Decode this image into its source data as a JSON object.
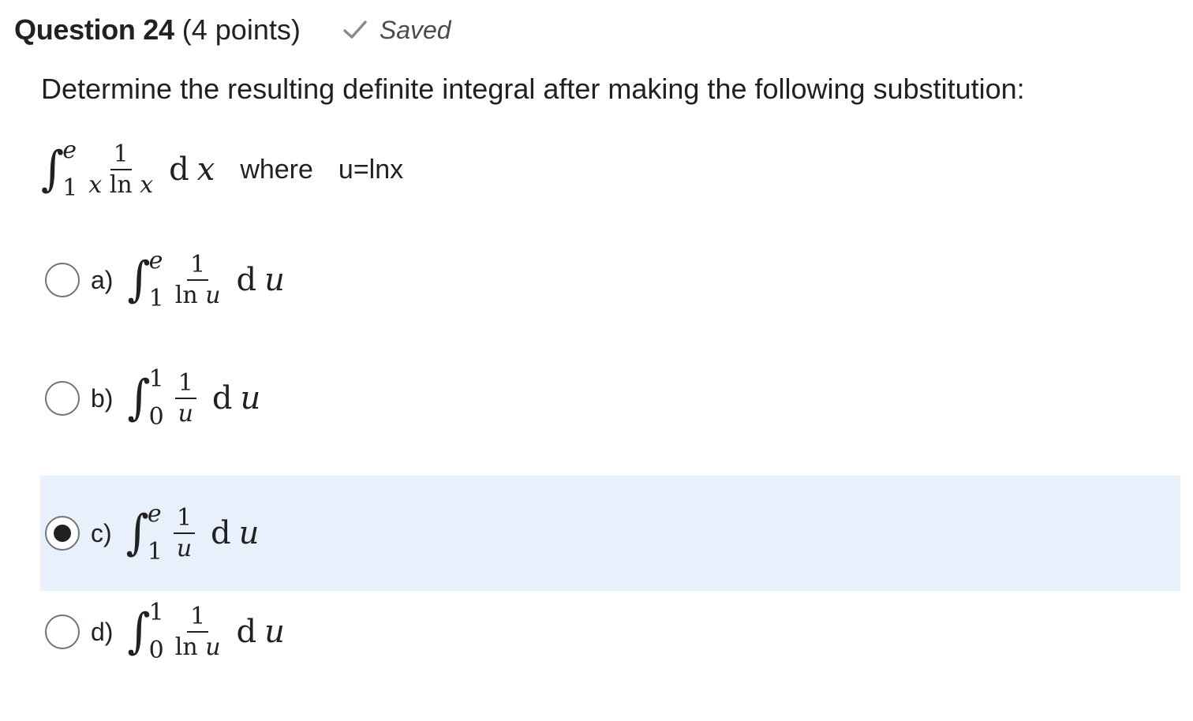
{
  "header": {
    "question_title": "Question 24",
    "points": "(4 points)",
    "saved_label": "Saved"
  },
  "prompt": "Determine the resulting definite integral after making the following substitution:",
  "given": {
    "lower": "1",
    "upper": "e",
    "numerator": "1",
    "den_var1": "x",
    "den_func": "ln",
    "den_var2": "x",
    "d": "d",
    "var": "x",
    "where_label": "where",
    "substitution": "u=lnx"
  },
  "options": [
    {
      "letter": "a)",
      "lower": "1",
      "upper": "e",
      "numerator": "1",
      "den_func": "ln",
      "den_var": "u",
      "d": "d",
      "var": "u",
      "selected": false
    },
    {
      "letter": "b)",
      "lower": "0",
      "upper": "1",
      "numerator": "1",
      "den_func": "",
      "den_var": "u",
      "d": "d",
      "var": "u",
      "selected": false
    },
    {
      "letter": "c)",
      "lower": "1",
      "upper": "e",
      "numerator": "1",
      "den_func": "",
      "den_var": "u",
      "d": "d",
      "var": "u",
      "selected": true
    },
    {
      "letter": "d)",
      "lower": "0",
      "upper": "1",
      "numerator": "1",
      "den_func": "ln",
      "den_var": "u",
      "d": "d",
      "var": "u",
      "selected": false
    }
  ],
  "colors": {
    "selected_bg": "#e8f1fb",
    "check": "#8a8d8f"
  },
  "icons": {
    "saved": "check-icon",
    "radio": "radio-icon"
  }
}
